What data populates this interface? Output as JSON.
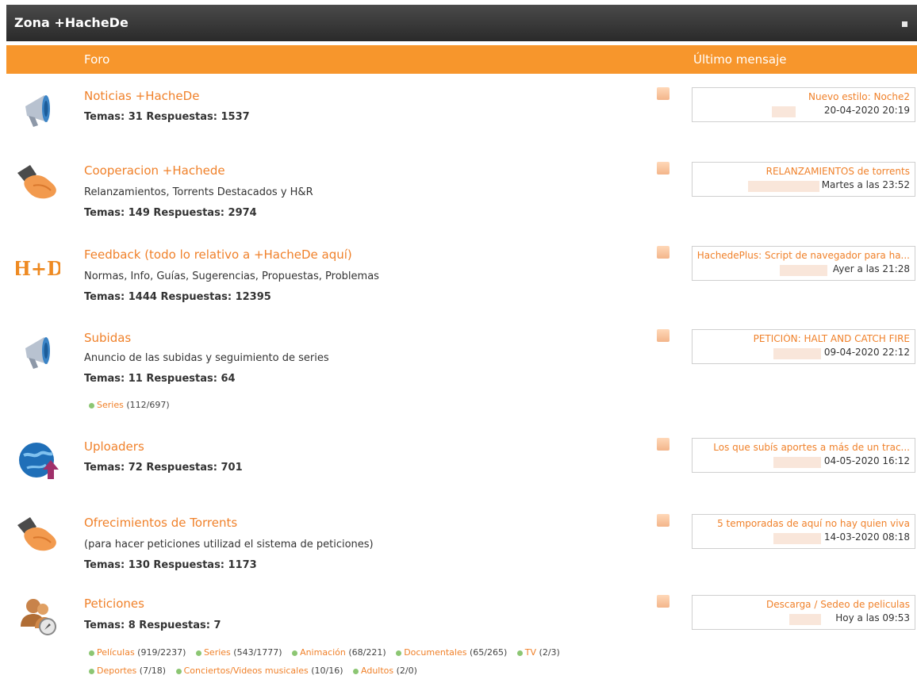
{
  "section": {
    "title": "Zona +HacheDe"
  },
  "columns": {
    "forum": "Foro",
    "last_post": "Último mensaje"
  },
  "forums": [
    {
      "name": "Noticias +HacheDe",
      "icon": "megaphone-icon",
      "description": "",
      "stats": "Temas: 31 Respuestas: 1537",
      "last": {
        "title": "Nuevo estilo: Noche2",
        "date": "20-04-2020 20:19"
      },
      "subforums": []
    },
    {
      "name": "Cooperacion +Hachede",
      "icon": "handshake-icon",
      "description": "Relanzamientos, Torrents Destacados y H&R",
      "stats": "Temas: 149 Respuestas: 2974",
      "last": {
        "title": "RELANZAMIENTOS de torrents",
        "date": "Martes a las 23:52"
      },
      "subforums": []
    },
    {
      "name": "Feedback (todo lo relativo a +HacheDe aquí)",
      "icon": "hd-logo-icon",
      "description": "Normas, Info, Guías, Sugerencias, Propuestas, Problemas",
      "stats": "Temas: 1444 Respuestas: 12395",
      "last": {
        "title": "HachedePlus: Script de navegador para ha...",
        "date": "Ayer a las 21:28"
      },
      "subforums": []
    },
    {
      "name": "Subidas",
      "icon": "megaphone-icon",
      "description": "Anuncio de las subidas y seguimiento de series",
      "stats": "Temas: 11 Respuestas: 64",
      "last": {
        "title": "PETICIÓN: HALT AND CATCH FIRE",
        "date": "09-04-2020 22:12"
      },
      "subforums": [
        {
          "name": "Series",
          "count": "(112/697)"
        }
      ]
    },
    {
      "name": "Uploaders",
      "icon": "globe-upload-icon",
      "description": "",
      "stats": "Temas: 72 Respuestas: 701",
      "last": {
        "title": "Los que subís aportes a más de un trac...",
        "date": "04-05-2020 16:12"
      },
      "subforums": []
    },
    {
      "name": "Ofrecimientos de Torrents",
      "icon": "handshake-icon",
      "description": "(para hacer peticiones utilizad el sistema de peticiones)",
      "stats": "Temas: 130 Respuestas: 1173",
      "last": {
        "title": "5 temporadas de aquí no hay quien viva",
        "date": "14-03-2020 08:18"
      },
      "subforums": []
    },
    {
      "name": "Peticiones",
      "icon": "users-compass-icon",
      "description": "",
      "stats": "Temas: 8 Respuestas: 7",
      "last": {
        "title": "Descarga / Sedeo de peliculas",
        "date": "Hoy a las 09:53"
      },
      "subforums": [
        {
          "name": "Películas",
          "count": "(919/2237)"
        },
        {
          "name": "Series",
          "count": "(543/1777)"
        },
        {
          "name": "Animación",
          "count": "(68/221)"
        },
        {
          "name": "Documentales",
          "count": "(65/265)"
        },
        {
          "name": "TV",
          "count": "(2/3)"
        },
        {
          "name": "Deportes",
          "count": "(7/18)"
        },
        {
          "name": "Conciertos/Videos musicales",
          "count": "(10/16)"
        },
        {
          "name": "Adultos",
          "count": "(2/0)"
        }
      ]
    }
  ]
}
